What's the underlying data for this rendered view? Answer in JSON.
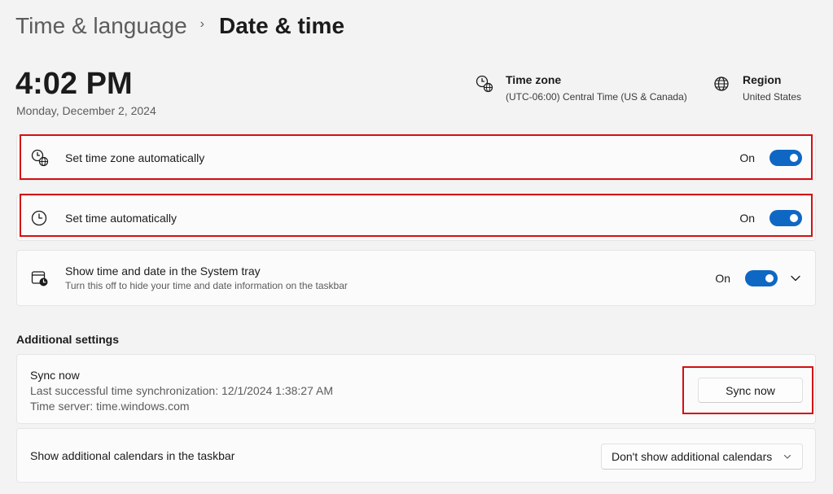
{
  "breadcrumb": {
    "parent": "Time & language",
    "separator": "›",
    "current": "Date & time"
  },
  "clock": {
    "time": "4:02 PM",
    "date": "Monday, December 2, 2024"
  },
  "time_zone_info": {
    "icon": "time-zone-icon",
    "title": "Time zone",
    "value": "(UTC-06:00) Central Time (US & Canada)"
  },
  "region_info": {
    "icon": "globe-icon",
    "title": "Region",
    "value": "United States"
  },
  "settings": [
    {
      "icon": "clock-globe-icon",
      "title": "Set time zone automatically",
      "state_label": "On",
      "enabled": true
    },
    {
      "icon": "clock-icon",
      "title": "Set time automatically",
      "state_label": "On",
      "enabled": true
    },
    {
      "icon": "calendar-clock-icon",
      "title": "Show time and date in the System tray",
      "subtitle": "Turn this off to hide your time and date information on the taskbar",
      "state_label": "On",
      "enabled": true,
      "expandable": true
    }
  ],
  "additional": {
    "section_title": "Additional settings",
    "sync": {
      "title": "Sync now",
      "last_sync": "Last successful time synchronization: 12/1/2024 1:38:27 AM",
      "server": "Time server: time.windows.com",
      "button_label": "Sync now"
    },
    "calendars": {
      "title": "Show additional calendars in the taskbar",
      "selected": "Don't show additional calendars"
    }
  },
  "colors": {
    "accent": "#0f67c4",
    "highlight": "#d40f14",
    "background": "#f3f3f3",
    "card": "#fbfbfb"
  }
}
